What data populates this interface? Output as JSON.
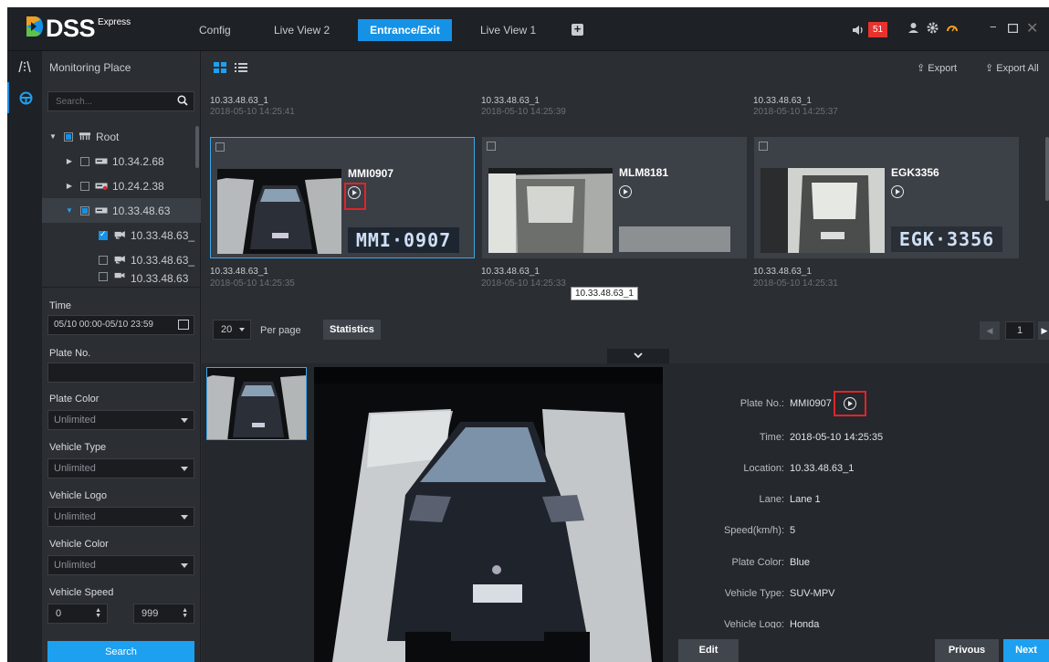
{
  "app": {
    "brand": "DSS",
    "edition": "Express",
    "tabs": [
      {
        "label": "Config"
      },
      {
        "label": "Live View 2"
      },
      {
        "label": "Entrance/Exit"
      },
      {
        "label": "Live View 1"
      }
    ],
    "alarm_count": "51"
  },
  "sidebar": {
    "title": "Monitoring Place",
    "search_placeholder": "Search...",
    "tree": [
      {
        "label": "Root"
      },
      {
        "label": "10.34.2.68"
      },
      {
        "label": "10.24.2.38"
      },
      {
        "label": "10.33.48.63"
      },
      {
        "label": "10.33.48.63_"
      },
      {
        "label": "10.33.48.63_"
      },
      {
        "label": "10.33.48.63"
      }
    ]
  },
  "filters": {
    "time_label": "Time",
    "time_value": "05/10 00:00-05/10 23:59",
    "plate_label": "Plate No.",
    "plate_value": "",
    "plate_color_label": "Plate Color",
    "plate_color_value": "Unlimited",
    "vehicle_type_label": "Vehicle Type",
    "vehicle_type_value": "Unlimited",
    "vehicle_logo_label": "Vehicle Logo",
    "vehicle_logo_value": "Unlimited",
    "vehicle_color_label": "Vehicle Color",
    "vehicle_color_value": "Unlimited",
    "speed_label": "Vehicle Speed",
    "speed_min": "0",
    "speed_max": "999",
    "search_button": "Search"
  },
  "toolbar": {
    "export": "Export",
    "export_all": "Export All"
  },
  "top_captions": [
    {
      "channel": "10.33.48.63_1",
      "time": "2018-05-10 14:25:41"
    },
    {
      "channel": "10.33.48.63_1",
      "time": "2018-05-10 14:25:39"
    },
    {
      "channel": "10.33.48.63_1",
      "time": "2018-05-10 14:25:37"
    }
  ],
  "cards": [
    {
      "plate": "MMI0907",
      "plate_img": "MMI·0907",
      "channel": "10.33.48.63_1",
      "time": "2018-05-10 14:25:35"
    },
    {
      "plate": "MLM8181",
      "plate_img": "",
      "channel": "10.33.48.63_1",
      "time": "2018-05-10 14:25:33"
    },
    {
      "plate": "EGK3356",
      "plate_img": "EGK·3356",
      "channel": "10.33.48.63_1",
      "time": "2018-05-10 14:25:31"
    }
  ],
  "tooltip": "10.33.48.63_1",
  "pager": {
    "per_page": "20",
    "per_page_label": "Per page",
    "statistics": "Statistics",
    "page": "1"
  },
  "detail": {
    "fields": [
      {
        "key": "Plate No.:",
        "value": "MMI0907"
      },
      {
        "key": "Time:",
        "value": "2018-05-10 14:25:35"
      },
      {
        "key": "Location:",
        "value": "10.33.48.63_1"
      },
      {
        "key": "Lane:",
        "value": "Lane 1"
      },
      {
        "key": "Speed(km/h):",
        "value": "5"
      },
      {
        "key": "Plate Color:",
        "value": "Blue"
      },
      {
        "key": "Vehicle Type:",
        "value": "SUV-MPV"
      },
      {
        "key": "Vehicle Logo:",
        "value": "Honda"
      }
    ],
    "edit": "Edit",
    "previous": "Privous",
    "next": "Next"
  },
  "colors": {
    "accent": "#1592e6",
    "highlight": "#e0242a",
    "background": "#2b2e33"
  }
}
